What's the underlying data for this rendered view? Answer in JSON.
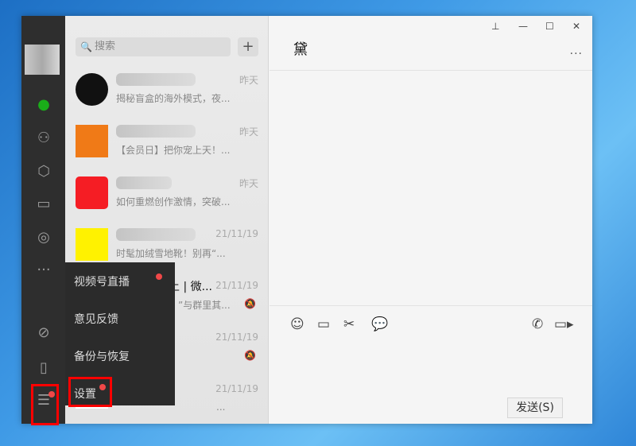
{
  "search": {
    "placeholder": "搜索",
    "add": "+"
  },
  "chat_list": [
    {
      "time": "昨天",
      "preview": "揭秘盲盒的海外模式，夜...",
      "avatar_color": "#111111"
    },
    {
      "time": "昨天",
      "preview": "【会员日】把你宠上天！...",
      "avatar_color": "#f07a17"
    },
    {
      "time": "昨天",
      "preview": "如何重燃创作激情，突破...",
      "avatar_color": "#f51d24"
    },
    {
      "time": "21/11/19",
      "preview": "时髦加绒雪地靴！别再“...",
      "avatar_color": "#fff200"
    },
    {
      "name_partial": "上 | 微...",
      "time": "21/11/19",
      "preview": "”与群里其...",
      "muted": true
    },
    {
      "time": "21/11/19",
      "preview": "",
      "muted": true
    },
    {
      "time": "21/11/19",
      "preview": "..."
    }
  ],
  "chat": {
    "title": "黛",
    "more": "...",
    "send": "发送(S)"
  },
  "window_controls": {
    "pin": "⊥",
    "minimize": "—",
    "maximize": "☐",
    "close": "✕"
  },
  "menu": {
    "items": [
      "视频号直播",
      "意见反馈",
      "备份与恢复",
      "设置"
    ]
  }
}
